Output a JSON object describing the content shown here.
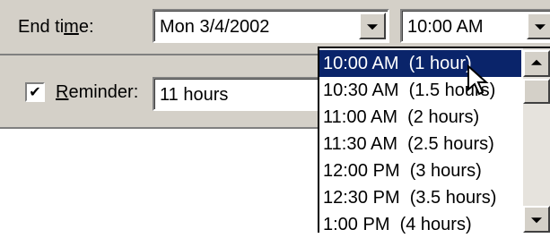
{
  "end_time": {
    "label_pre": "End ti",
    "label_mnemonic": "m",
    "label_post": "e:",
    "date_value": "Mon 3/4/2002",
    "time_value": "10:00 AM"
  },
  "reminder": {
    "checked_mark": "✔",
    "label_mnemonic": "R",
    "label_rest": "eminder:",
    "value": "11 hours"
  },
  "time_dropdown": {
    "items": [
      "10:00 AM  (1 hour)",
      "10:30 AM  (1.5 hours)",
      "11:00 AM  (2 hours)",
      "11:30 AM  (2.5 hours)",
      "12:00 PM  (3 hours)",
      "12:30 PM  (3.5 hours)",
      "1:00 PM  (4 hours)"
    ],
    "selected_index": 0
  },
  "icons": {
    "dropdown": "chevron-down-icon",
    "scroll_up": "scroll-up-icon",
    "scroll_down": "scroll-down-icon",
    "cursor": "mouse-pointer-icon"
  },
  "colors": {
    "dialog_bg": "#d4d0c8",
    "selection_bg": "#0a246a",
    "selection_text": "#ffffff"
  }
}
